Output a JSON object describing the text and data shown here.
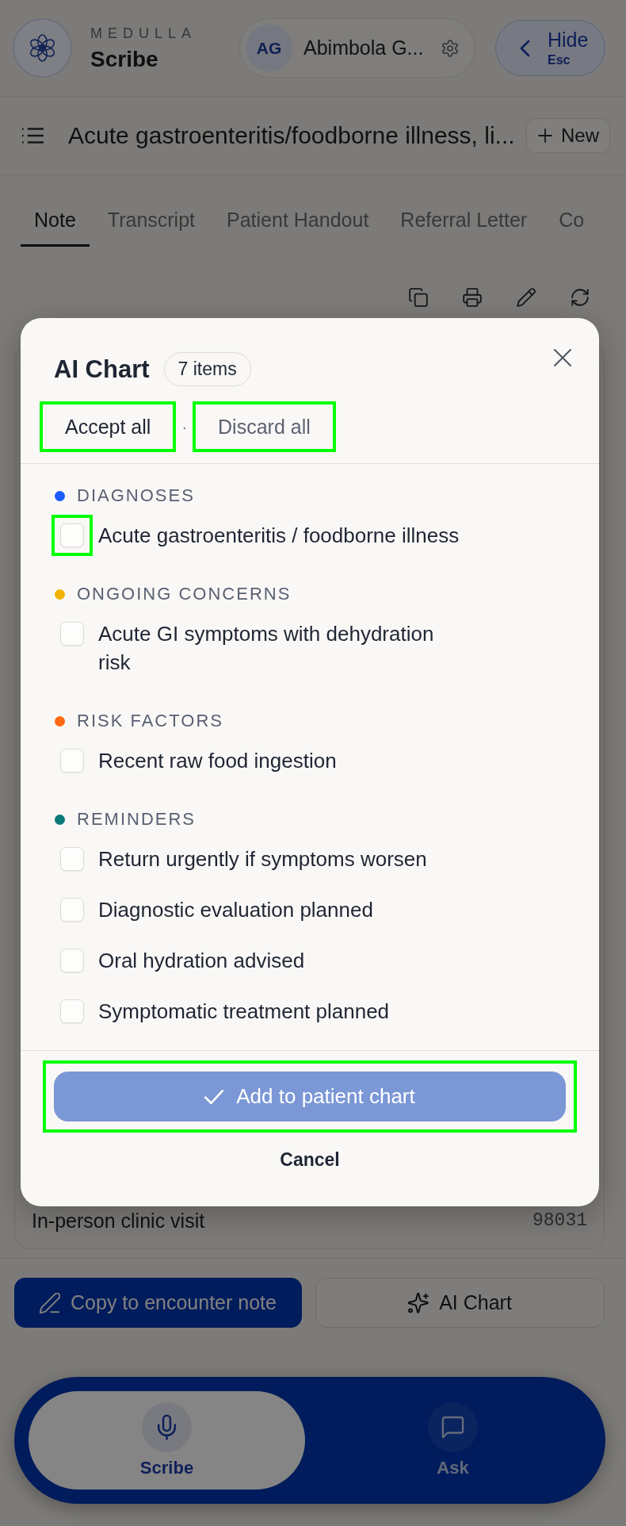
{
  "header": {
    "brand": "MEDULLA",
    "product": "Scribe",
    "user": {
      "initials": "AG",
      "name": "Abimbola G..."
    },
    "hide_button": {
      "label": "Hide",
      "shortcut": "Esc"
    }
  },
  "note_bar": {
    "title": "Acute gastroenteritis/foodborne illness, li...",
    "new_button": "New"
  },
  "tabs": [
    {
      "label": "Note",
      "selected": true
    },
    {
      "label": "Transcript",
      "selected": false
    },
    {
      "label": "Patient Handout",
      "selected": false
    },
    {
      "label": "Referral Letter",
      "selected": false
    },
    {
      "label": "Co",
      "selected": false
    }
  ],
  "note_card": {
    "visit_type": "In-person clinic visit",
    "code": "98031"
  },
  "actions": [
    {
      "kind": "copy",
      "label": "Copy to encounter note"
    },
    {
      "kind": "chart",
      "label": "AI Chart"
    }
  ],
  "bottom_nav": [
    {
      "kind": "voice",
      "label": "Scribe",
      "selected": true
    },
    {
      "kind": "chat",
      "label": "Ask",
      "selected": false
    }
  ],
  "dialog": {
    "title": "AI Chart",
    "count": "7 items",
    "bulk_actions": [
      {
        "kind": "accept",
        "label": "Accept all",
        "highlighted": true
      },
      {
        "kind": "discard",
        "label": "Discard all",
        "highlighted": true
      }
    ],
    "separator": "·",
    "sections": [
      {
        "title": "DIAGNOSES",
        "color": "#1a5cff",
        "items": [
          {
            "label": "Acute gastroenteritis / foodborne illness",
            "checked": false,
            "highlighted": true
          }
        ]
      },
      {
        "title": "ONGOING CONCERNS",
        "color": "#f0b400",
        "items": [
          {
            "label": "Acute GI symptoms with dehydration risk",
            "checked": false,
            "highlighted": false
          }
        ]
      },
      {
        "title": "RISK FACTORS",
        "color": "#ff6a13",
        "items": [
          {
            "label": "Recent raw food ingestion",
            "checked": false,
            "highlighted": false
          }
        ]
      },
      {
        "title": "REMINDERS",
        "color": "#0a7a78",
        "items": [
          {
            "label": "Return urgently if symptoms worsen",
            "checked": false,
            "highlighted": false
          },
          {
            "label": "Diagnostic evaluation planned",
            "checked": false,
            "highlighted": false
          },
          {
            "label": "Oral hydration advised",
            "checked": false,
            "highlighted": false
          },
          {
            "label": "Symptomatic treatment planned",
            "checked": false,
            "highlighted": false
          }
        ]
      }
    ],
    "confirm": {
      "label": "Add to patient chart",
      "disabled": true,
      "highlighted": true
    },
    "cancel": "Cancel"
  }
}
